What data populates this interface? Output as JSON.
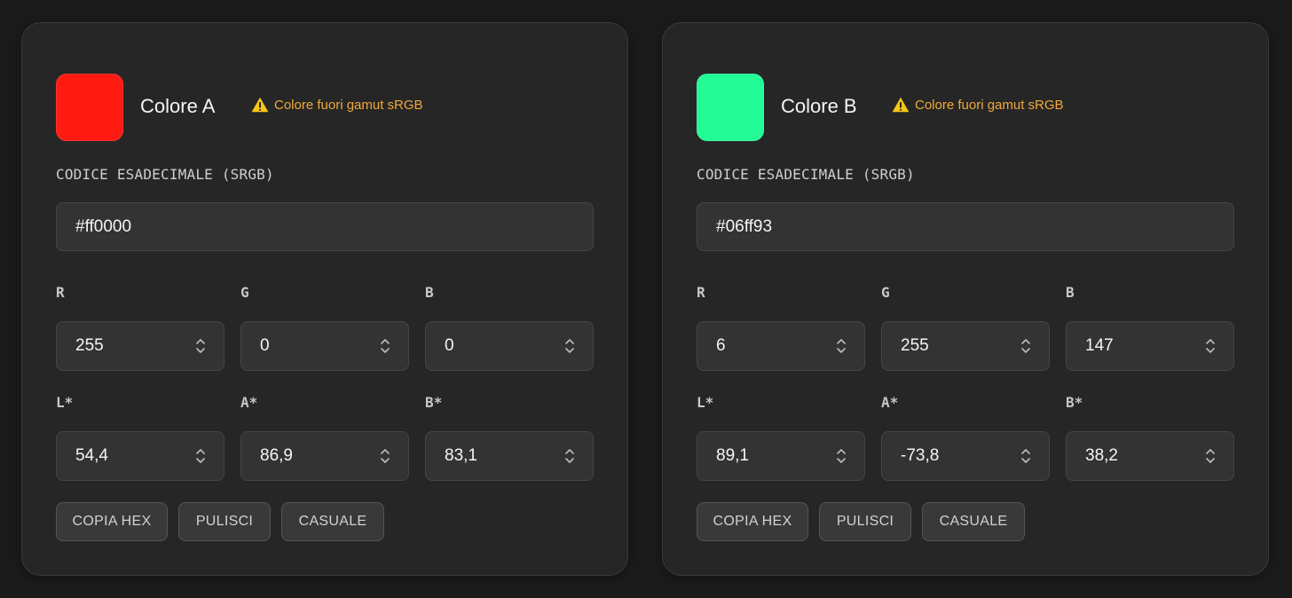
{
  "cards": [
    {
      "title": "Colore A",
      "swatch_color": "#ff1a12",
      "warning_icon": "warning-icon",
      "warning": "Colore fuori gamut sRGB",
      "hex_label": "CODICE ESADECIMALE (SRGB)",
      "hex_value": "#ff0000",
      "rgb": [
        {
          "label": "R",
          "value": "255"
        },
        {
          "label": "G",
          "value": "0"
        },
        {
          "label": "B",
          "value": "0"
        }
      ],
      "lab": [
        {
          "label": "L*",
          "value": "54,4"
        },
        {
          "label": "A*",
          "value": "86,9"
        },
        {
          "label": "B*",
          "value": "83,1"
        }
      ],
      "buttons": {
        "copy": "COPIA HEX",
        "clear": "PULISCI",
        "random": "CASUALE"
      }
    },
    {
      "title": "Colore B",
      "swatch_color": "#22fb96",
      "warning_icon": "warning-icon",
      "warning": "Colore fuori gamut sRGB",
      "hex_label": "CODICE ESADECIMALE (SRGB)",
      "hex_value": "#06ff93",
      "rgb": [
        {
          "label": "R",
          "value": "6"
        },
        {
          "label": "G",
          "value": "255"
        },
        {
          "label": "B",
          "value": "147"
        }
      ],
      "lab": [
        {
          "label": "L*",
          "value": "89,1"
        },
        {
          "label": "A*",
          "value": "-73,8"
        },
        {
          "label": "B*",
          "value": "38,2"
        }
      ],
      "buttons": {
        "copy": "COPIA HEX",
        "clear": "PULISCI",
        "random": "CASUALE"
      }
    }
  ],
  "colors": {
    "background": "#1b1b1b",
    "card": "#262626",
    "field": "#333333",
    "warning": "#f0a93a",
    "warning_icon": "#f5c518"
  }
}
